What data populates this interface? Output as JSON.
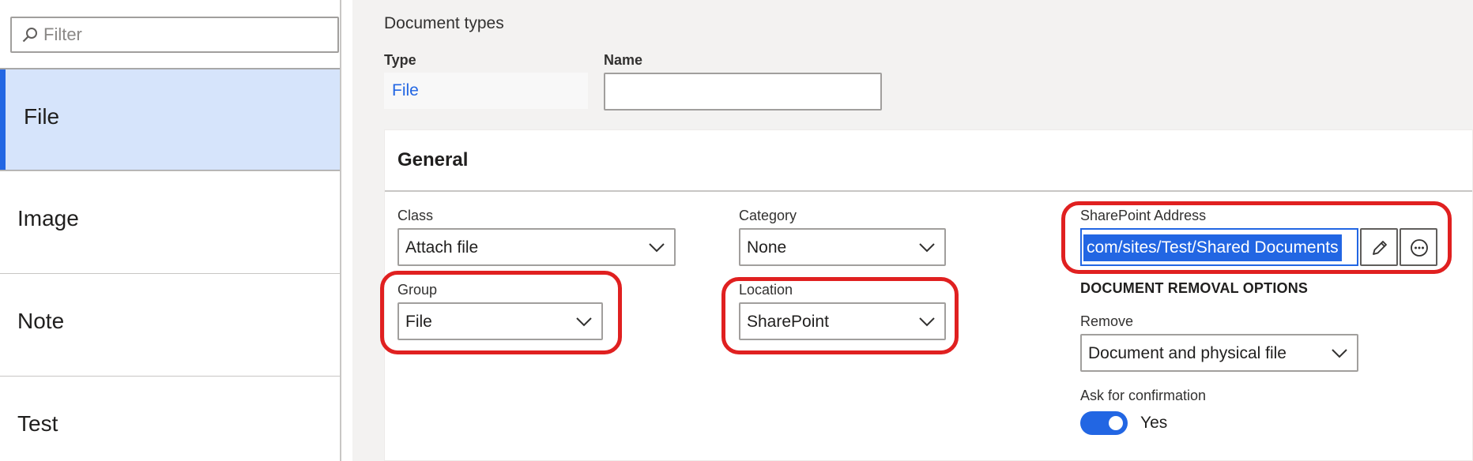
{
  "filter": {
    "placeholder": "Filter",
    "icon": "search-icon"
  },
  "nav": {
    "items": [
      {
        "label": "File",
        "selected": true
      },
      {
        "label": "Image",
        "selected": false
      },
      {
        "label": "Note",
        "selected": false
      },
      {
        "label": "Test",
        "selected": false
      }
    ]
  },
  "page": {
    "title": "Document types",
    "type_label": "Type",
    "type_value": "File",
    "name_label": "Name",
    "name_value": ""
  },
  "general": {
    "title": "General",
    "class": {
      "label": "Class",
      "value": "Attach file"
    },
    "category": {
      "label": "Category",
      "value": "None"
    },
    "group": {
      "label": "Group",
      "value": "File"
    },
    "location": {
      "label": "Location",
      "value": "SharePoint"
    },
    "sharepoint": {
      "label": "SharePoint Address",
      "value": "com/sites/Test/Shared Documents"
    },
    "removal_heading": "DOCUMENT REMOVAL OPTIONS",
    "remove": {
      "label": "Remove",
      "value": "Document and physical file"
    },
    "confirm": {
      "label": "Ask for confirmation",
      "value": "Yes",
      "on": true
    }
  },
  "colors": {
    "accent": "#2266e3",
    "selected_bg": "#d6e4fb",
    "highlight": "#e02020"
  }
}
